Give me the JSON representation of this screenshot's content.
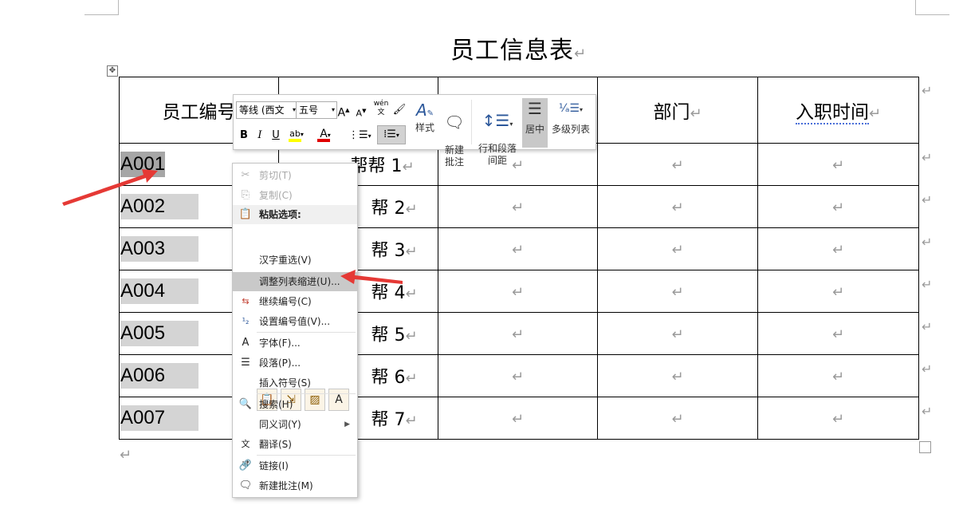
{
  "document": {
    "title": "员工信息表",
    "para_mark": "↵",
    "table": {
      "headers": [
        "员工编号",
        "",
        "",
        "部门",
        "入职时间"
      ],
      "rows": [
        {
          "id": "A001",
          "name": "帮帮 1"
        },
        {
          "id": "A002",
          "name": "帮 2"
        },
        {
          "id": "A003",
          "name": "帮 3"
        },
        {
          "id": "A004",
          "name": "帮 4"
        },
        {
          "id": "A005",
          "name": "帮 5"
        },
        {
          "id": "A006",
          "name": "帮 6"
        },
        {
          "id": "A007",
          "name": "帮 7"
        }
      ]
    }
  },
  "mini_toolbar": {
    "font_name": "等线 (西文",
    "font_size": "五号",
    "grow_font": "A",
    "shrink_font": "A",
    "phonetic": "wén 文",
    "bold": "B",
    "italic": "I",
    "underline": "U",
    "styles_label": "样式",
    "new_comment_label": "新建\n批注",
    "line_spacing_label": "行和段落\n间距",
    "center_label": "居中",
    "multilevel_label": "多级列表"
  },
  "context_menu": {
    "items": [
      {
        "label": "剪切(T)",
        "icon": "scissors-icon",
        "disabled": true
      },
      {
        "label": "复制(C)",
        "icon": "copy-icon",
        "disabled": true
      },
      {
        "label": "粘贴选项:",
        "icon": "paste-icon",
        "heading": true
      },
      {
        "label": "汉字重选(V)"
      },
      {
        "label": "调整列表缩进(U)...",
        "highlighted": true
      },
      {
        "label": "继续编号(C)",
        "icon": "continue-numbering-icon"
      },
      {
        "label": "设置编号值(V)...",
        "icon": "set-numbering-value-icon"
      },
      {
        "label": "字体(F)...",
        "icon": "font-icon"
      },
      {
        "label": "段落(P)...",
        "icon": "paragraph-icon"
      },
      {
        "label": "插入符号(S)"
      },
      {
        "label": "搜索(H)",
        "icon": "search-icon"
      },
      {
        "label": "同义词(Y)",
        "submenu": true
      },
      {
        "label": "翻译(S)",
        "icon": "translate-icon"
      },
      {
        "label": "链接(I)",
        "icon": "link-icon"
      },
      {
        "label": "新建批注(M)",
        "icon": "new-comment-icon"
      }
    ]
  },
  "colors": {
    "highlight": "#ffff00",
    "font_color": "#e00000",
    "arrow": "#e53935",
    "selection": "#a6a6a6"
  }
}
